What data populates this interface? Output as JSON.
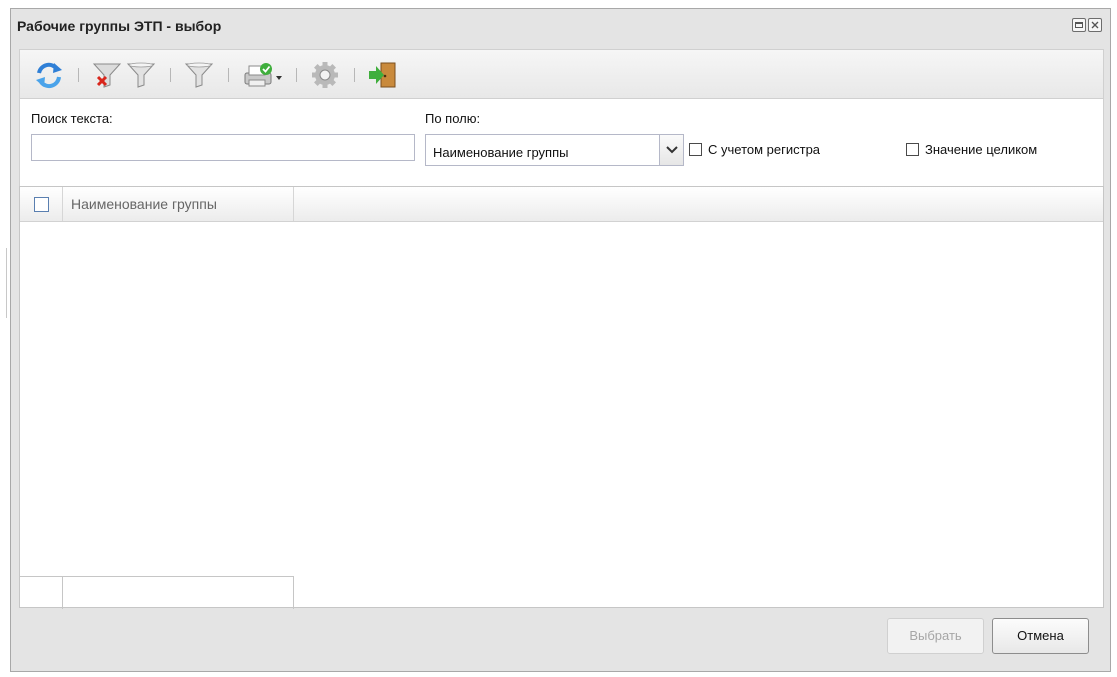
{
  "window": {
    "title": "Рабочие группы ЭТП - выбор"
  },
  "toolbar": {
    "buttons": [
      {
        "name": "refresh-icon"
      },
      {
        "name": "clear-filter-icon"
      },
      {
        "name": "filter-icon"
      },
      {
        "name": "filter-icon-2"
      },
      {
        "name": "print-icon"
      },
      {
        "name": "settings-icon"
      },
      {
        "name": "exit-icon"
      }
    ]
  },
  "search": {
    "text_label": "Поиск текста:",
    "text_value": "",
    "field_label": "По полю:",
    "field_value": "Наименование группы",
    "case_label": "С учетом регистра",
    "case_checked": false,
    "whole_label": "Значение целиком",
    "whole_checked": false
  },
  "grid": {
    "columns": [
      "Наименование группы"
    ],
    "rows": []
  },
  "footer": {
    "select_label": "Выбрать",
    "cancel_label": "Отмена"
  },
  "colors": {
    "window_bg": "#e4e4e4",
    "disabled_text": "#a6a6a6"
  }
}
